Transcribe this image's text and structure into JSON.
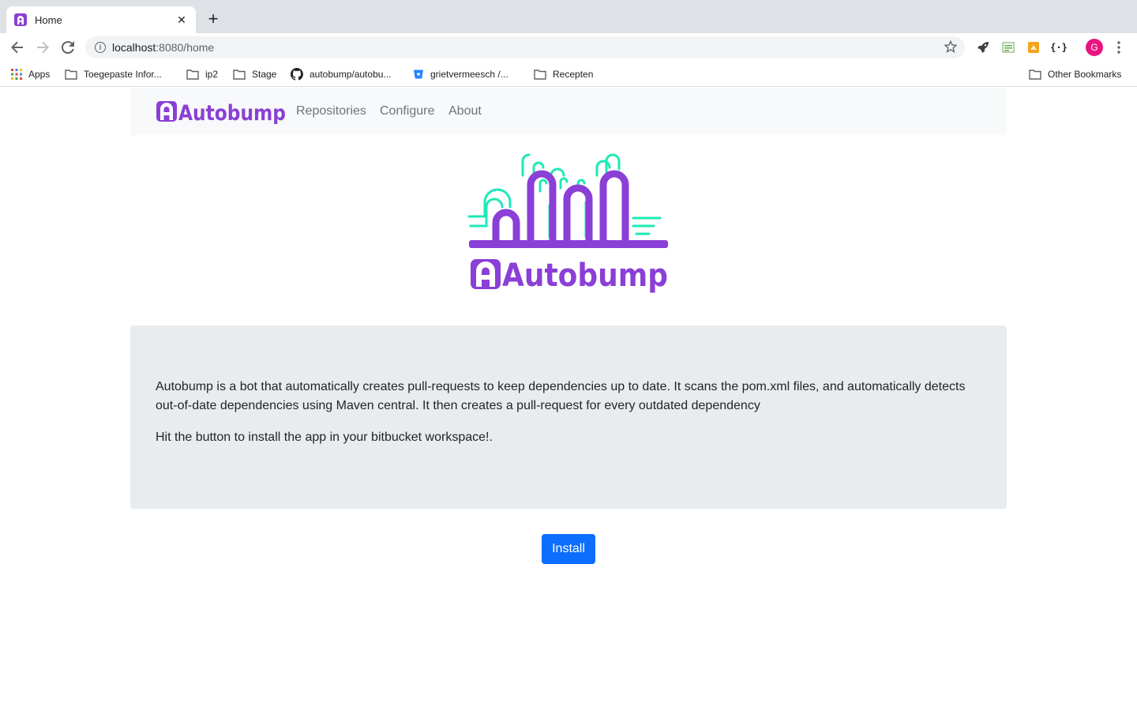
{
  "browser": {
    "tab_title": "Home",
    "url_host": "localhost",
    "url_path": ":8080/home",
    "avatar_letter": "G",
    "bookmarks": [
      {
        "label": "Apps",
        "icon": "apps-grid-icon"
      },
      {
        "label": "Toegepaste Infor...",
        "icon": "folder-icon"
      },
      {
        "label": "ip2",
        "icon": "folder-icon"
      },
      {
        "label": "Stage",
        "icon": "folder-icon"
      },
      {
        "label": "autobump/autobu...",
        "icon": "github-icon"
      },
      {
        "label": "grietvermeesch /...",
        "icon": "bitbucket-icon"
      },
      {
        "label": "Recepten",
        "icon": "folder-icon"
      }
    ],
    "other_bookmarks": "Other Bookmarks"
  },
  "navbar": {
    "brand": "Autobump",
    "links": [
      "Repositories",
      "Configure",
      "About"
    ]
  },
  "hero": {
    "logo_text": "Autobump"
  },
  "jumbotron": {
    "paragraph1": "Autobump is a bot that automatically creates pull-requests to keep dependencies up to date. It scans the pom.xml files, and automatically detects out-of-date dependencies using Maven central. It then creates a pull-request for every outdated dependency",
    "paragraph2": "Hit the button to install the app in your bitbucket workspace!."
  },
  "install_button": "Install",
  "colors": {
    "brand_purple": "#8a3fd6",
    "accent_teal": "#1de9b6",
    "primary_button": "#0d6efd"
  }
}
